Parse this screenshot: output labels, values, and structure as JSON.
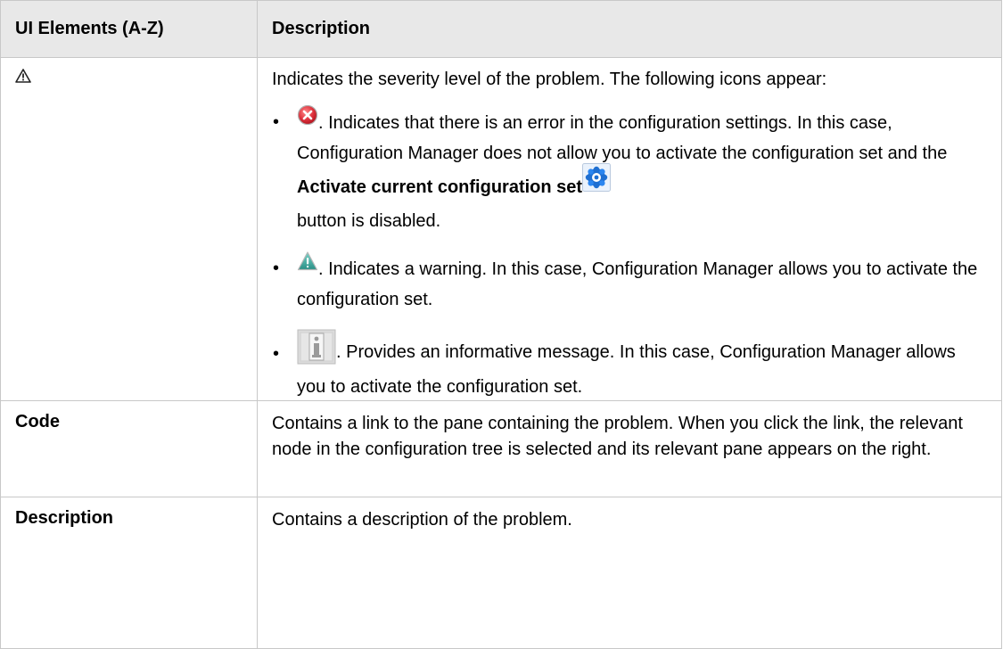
{
  "table": {
    "headers": {
      "elements": "UI Elements (A-Z)",
      "description": "Description"
    },
    "rows": [
      {
        "element_icon": "warning-triangle-icon",
        "intro": "Indicates the severity level of the problem. The following icons appear:",
        "items": [
          {
            "icon": "error-icon",
            "text_before": ". Indicates that there is an error in the configuration settings. In this case, Configuration Manager does not allow you to activate the configuration set and the ",
            "bold": "Activate current configuration set",
            "activate_icon": "activate-configuration-icon",
            "text_after": "button is disabled."
          },
          {
            "icon": "warning-icon",
            "text": ". Indicates a warning. In this case, Configuration Manager allows you to activate the configuration set."
          },
          {
            "icon": "info-icon",
            "text": ". Provides an informative message. In this case, Configuration Manager allows you to activate the configuration set."
          }
        ]
      },
      {
        "element": "Code",
        "description": "Contains a link to the pane containing the problem. When you click the link, the relevant node in the configuration tree is selected and its relevant pane appears on the right."
      },
      {
        "element": "Description",
        "description": "Contains a description of the problem."
      }
    ]
  },
  "bullet_char": "•",
  "colors": {
    "header_bg": "#e8e8e8",
    "border": "#c8c8c8",
    "error_red": "#d9303a",
    "warning_teal": "#3aa39a",
    "info_gray": "#9a9a9a",
    "activate_blue": "#1f6fd1"
  }
}
